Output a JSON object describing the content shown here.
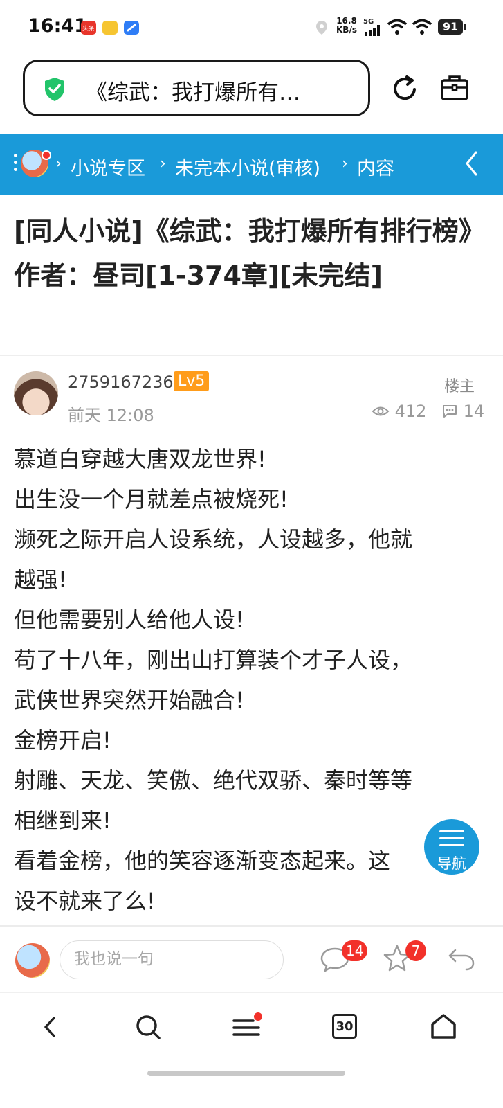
{
  "status_bar": {
    "time": "16:41",
    "app_icons": [
      "toutiao-icon",
      "notes-icon",
      "browser-icon"
    ],
    "net_speed_value": "16.8",
    "net_speed_unit": "KB/s",
    "network": "5G",
    "battery": "91"
  },
  "browser": {
    "url_title": "《综武：我打爆所有…"
  },
  "breadcrumb": {
    "items": [
      "小说专区",
      "未完本小说(审核)",
      "内容"
    ]
  },
  "thread": {
    "title": "[同人小说]《综武：我打爆所有排行榜》作者：昼司[1-374章][未完结]"
  },
  "post": {
    "username": "2759167236",
    "level": "Lv5",
    "role": "楼主",
    "time": "前天 12:08",
    "views": "412",
    "replies": "14",
    "lines": [
      "慕道白穿越大唐双龙世界!",
      "出生没一个月就差点被烧死!",
      "濒死之际开启人设系统，人设越多，他就",
      "越强!",
      "但他需要别人给他人设!",
      "苟了十八年，刚出山打算装个才子人设，",
      "武侠世界突然开始融合!",
      "金榜开启!",
      "射雕、天龙、笑傲、绝代双骄、秦时等等",
      "相继到来!",
      "看着金榜，他的笑容逐渐变态起来。这",
      "设不就来了么!"
    ]
  },
  "floating_nav": {
    "label": "导航"
  },
  "reply_bar": {
    "placeholder": "我也说一句",
    "comment_count": "14",
    "favorite_count": "7"
  },
  "bottom_nav": {
    "tabs_count": "30"
  },
  "colors": {
    "accent": "#1a9ad9",
    "badge": "#f2312a",
    "level": "#ff9c1a"
  }
}
